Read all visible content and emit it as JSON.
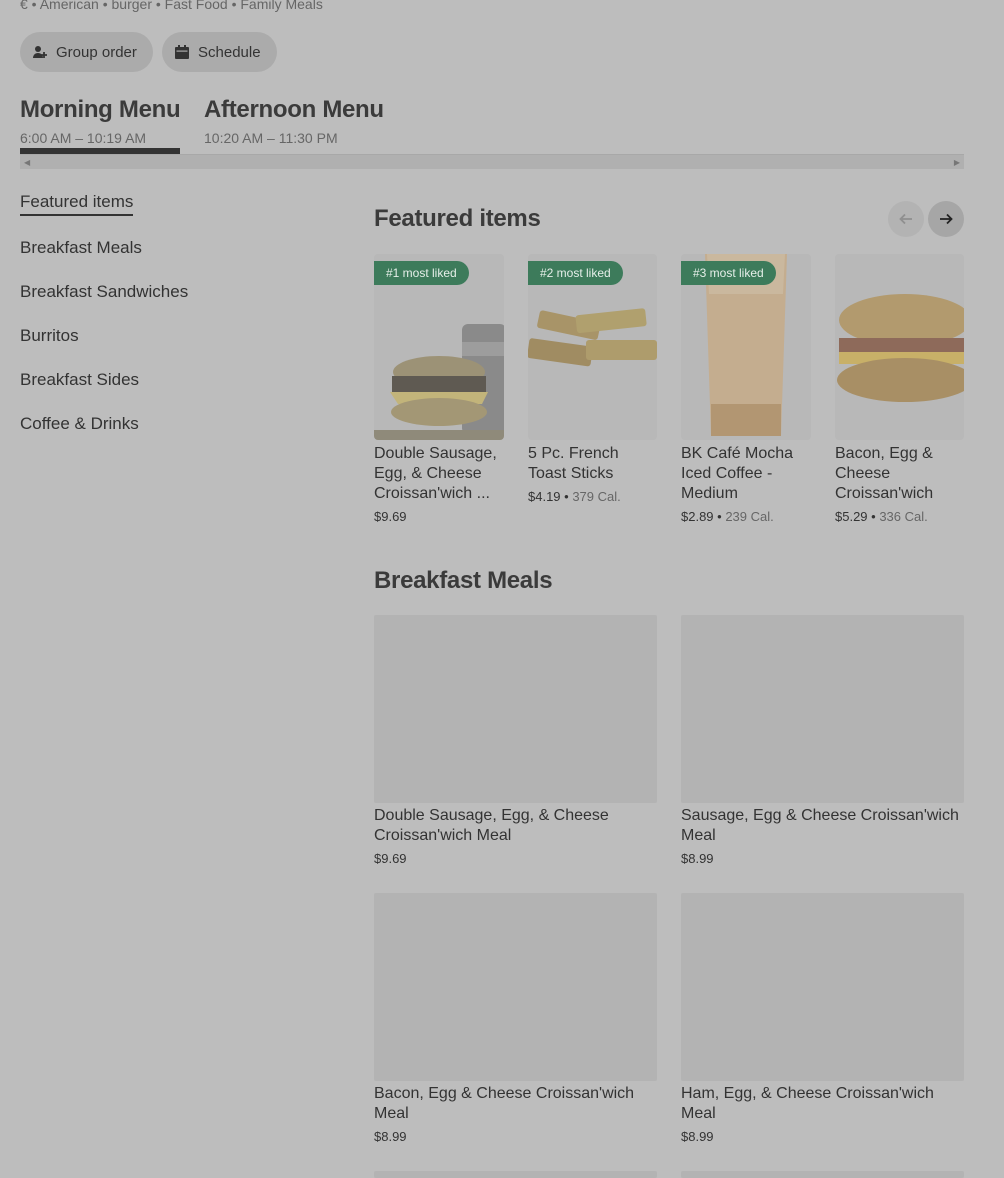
{
  "store": {
    "tagline": "€ • American • burger • Fast Food • Family Meals"
  },
  "actions": {
    "group_order": "Group order",
    "schedule": "Schedule"
  },
  "menus": [
    {
      "title": "Morning Menu",
      "hours": "6:00 AM – 10:19 AM"
    },
    {
      "title": "Afternoon Menu",
      "hours": "10:20 AM – 11:30 PM"
    }
  ],
  "sidebar": {
    "items": [
      {
        "label": "Featured items"
      },
      {
        "label": "Breakfast Meals"
      },
      {
        "label": "Breakfast Sandwiches"
      },
      {
        "label": "Burritos"
      },
      {
        "label": "Breakfast Sides"
      },
      {
        "label": "Coffee & Drinks"
      }
    ]
  },
  "featured": {
    "title": "Featured items",
    "items": [
      {
        "badge": "#1 most liked",
        "name": "Double Sausage, Egg, & Cheese Croissan'wich ...",
        "price": "$9.69",
        "calories": ""
      },
      {
        "badge": "#2 most liked",
        "name": "5 Pc. French Toast Sticks",
        "price": "$4.19",
        "calories": "379 Cal."
      },
      {
        "badge": "#3 most liked",
        "name": "BK Café Mocha Iced Coffee - Medium",
        "price": "$2.89",
        "calories": "239 Cal."
      },
      {
        "badge": "",
        "name": "Bacon, Egg & Cheese Croissan'wich",
        "price": "$5.29",
        "calories": "336 Cal."
      }
    ]
  },
  "breakfast_meals": {
    "title": "Breakfast Meals",
    "items": [
      {
        "name": "Double Sausage, Egg, & Cheese Croissan'wich Meal",
        "price": "$9.69"
      },
      {
        "name": "Sausage, Egg & Cheese Croissan'wich Meal",
        "price": "$8.99"
      },
      {
        "name": "Bacon, Egg & Cheese Croissan'wich Meal",
        "price": "$8.99"
      },
      {
        "name": "Ham, Egg, & Cheese Croissan'wich Meal",
        "price": "$8.99"
      }
    ]
  },
  "colors": {
    "overlay_bg": "#bdbdbd",
    "badge_green": "#3d7b5b",
    "text_dark": "#333333"
  }
}
